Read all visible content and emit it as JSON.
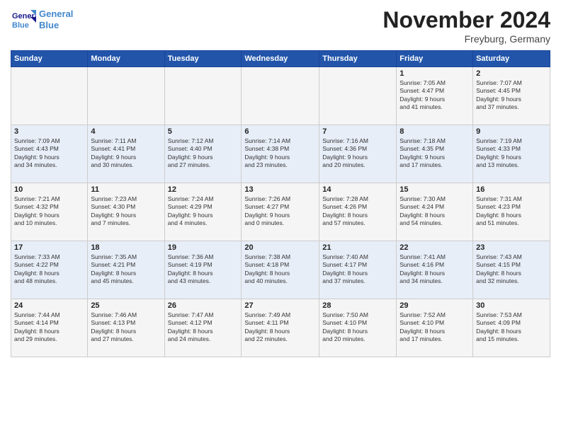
{
  "header": {
    "logo_line1": "General",
    "logo_line2": "Blue",
    "title": "November 2024",
    "subtitle": "Freyburg, Germany"
  },
  "weekdays": [
    "Sunday",
    "Monday",
    "Tuesday",
    "Wednesday",
    "Thursday",
    "Friday",
    "Saturday"
  ],
  "weeks": [
    [
      {
        "day": "",
        "info": ""
      },
      {
        "day": "",
        "info": ""
      },
      {
        "day": "",
        "info": ""
      },
      {
        "day": "",
        "info": ""
      },
      {
        "day": "",
        "info": ""
      },
      {
        "day": "1",
        "info": "Sunrise: 7:05 AM\nSunset: 4:47 PM\nDaylight: 9 hours\nand 41 minutes."
      },
      {
        "day": "2",
        "info": "Sunrise: 7:07 AM\nSunset: 4:45 PM\nDaylight: 9 hours\nand 37 minutes."
      }
    ],
    [
      {
        "day": "3",
        "info": "Sunrise: 7:09 AM\nSunset: 4:43 PM\nDaylight: 9 hours\nand 34 minutes."
      },
      {
        "day": "4",
        "info": "Sunrise: 7:11 AM\nSunset: 4:41 PM\nDaylight: 9 hours\nand 30 minutes."
      },
      {
        "day": "5",
        "info": "Sunrise: 7:12 AM\nSunset: 4:40 PM\nDaylight: 9 hours\nand 27 minutes."
      },
      {
        "day": "6",
        "info": "Sunrise: 7:14 AM\nSunset: 4:38 PM\nDaylight: 9 hours\nand 23 minutes."
      },
      {
        "day": "7",
        "info": "Sunrise: 7:16 AM\nSunset: 4:36 PM\nDaylight: 9 hours\nand 20 minutes."
      },
      {
        "day": "8",
        "info": "Sunrise: 7:18 AM\nSunset: 4:35 PM\nDaylight: 9 hours\nand 17 minutes."
      },
      {
        "day": "9",
        "info": "Sunrise: 7:19 AM\nSunset: 4:33 PM\nDaylight: 9 hours\nand 13 minutes."
      }
    ],
    [
      {
        "day": "10",
        "info": "Sunrise: 7:21 AM\nSunset: 4:32 PM\nDaylight: 9 hours\nand 10 minutes."
      },
      {
        "day": "11",
        "info": "Sunrise: 7:23 AM\nSunset: 4:30 PM\nDaylight: 9 hours\nand 7 minutes."
      },
      {
        "day": "12",
        "info": "Sunrise: 7:24 AM\nSunset: 4:29 PM\nDaylight: 9 hours\nand 4 minutes."
      },
      {
        "day": "13",
        "info": "Sunrise: 7:26 AM\nSunset: 4:27 PM\nDaylight: 9 hours\nand 0 minutes."
      },
      {
        "day": "14",
        "info": "Sunrise: 7:28 AM\nSunset: 4:26 PM\nDaylight: 8 hours\nand 57 minutes."
      },
      {
        "day": "15",
        "info": "Sunrise: 7:30 AM\nSunset: 4:24 PM\nDaylight: 8 hours\nand 54 minutes."
      },
      {
        "day": "16",
        "info": "Sunrise: 7:31 AM\nSunset: 4:23 PM\nDaylight: 8 hours\nand 51 minutes."
      }
    ],
    [
      {
        "day": "17",
        "info": "Sunrise: 7:33 AM\nSunset: 4:22 PM\nDaylight: 8 hours\nand 48 minutes."
      },
      {
        "day": "18",
        "info": "Sunrise: 7:35 AM\nSunset: 4:21 PM\nDaylight: 8 hours\nand 45 minutes."
      },
      {
        "day": "19",
        "info": "Sunrise: 7:36 AM\nSunset: 4:19 PM\nDaylight: 8 hours\nand 43 minutes."
      },
      {
        "day": "20",
        "info": "Sunrise: 7:38 AM\nSunset: 4:18 PM\nDaylight: 8 hours\nand 40 minutes."
      },
      {
        "day": "21",
        "info": "Sunrise: 7:40 AM\nSunset: 4:17 PM\nDaylight: 8 hours\nand 37 minutes."
      },
      {
        "day": "22",
        "info": "Sunrise: 7:41 AM\nSunset: 4:16 PM\nDaylight: 8 hours\nand 34 minutes."
      },
      {
        "day": "23",
        "info": "Sunrise: 7:43 AM\nSunset: 4:15 PM\nDaylight: 8 hours\nand 32 minutes."
      }
    ],
    [
      {
        "day": "24",
        "info": "Sunrise: 7:44 AM\nSunset: 4:14 PM\nDaylight: 8 hours\nand 29 minutes."
      },
      {
        "day": "25",
        "info": "Sunrise: 7:46 AM\nSunset: 4:13 PM\nDaylight: 8 hours\nand 27 minutes."
      },
      {
        "day": "26",
        "info": "Sunrise: 7:47 AM\nSunset: 4:12 PM\nDaylight: 8 hours\nand 24 minutes."
      },
      {
        "day": "27",
        "info": "Sunrise: 7:49 AM\nSunset: 4:11 PM\nDaylight: 8 hours\nand 22 minutes."
      },
      {
        "day": "28",
        "info": "Sunrise: 7:50 AM\nSunset: 4:10 PM\nDaylight: 8 hours\nand 20 minutes."
      },
      {
        "day": "29",
        "info": "Sunrise: 7:52 AM\nSunset: 4:10 PM\nDaylight: 8 hours\nand 17 minutes."
      },
      {
        "day": "30",
        "info": "Sunrise: 7:53 AM\nSunset: 4:09 PM\nDaylight: 8 hours\nand 15 minutes."
      }
    ]
  ]
}
